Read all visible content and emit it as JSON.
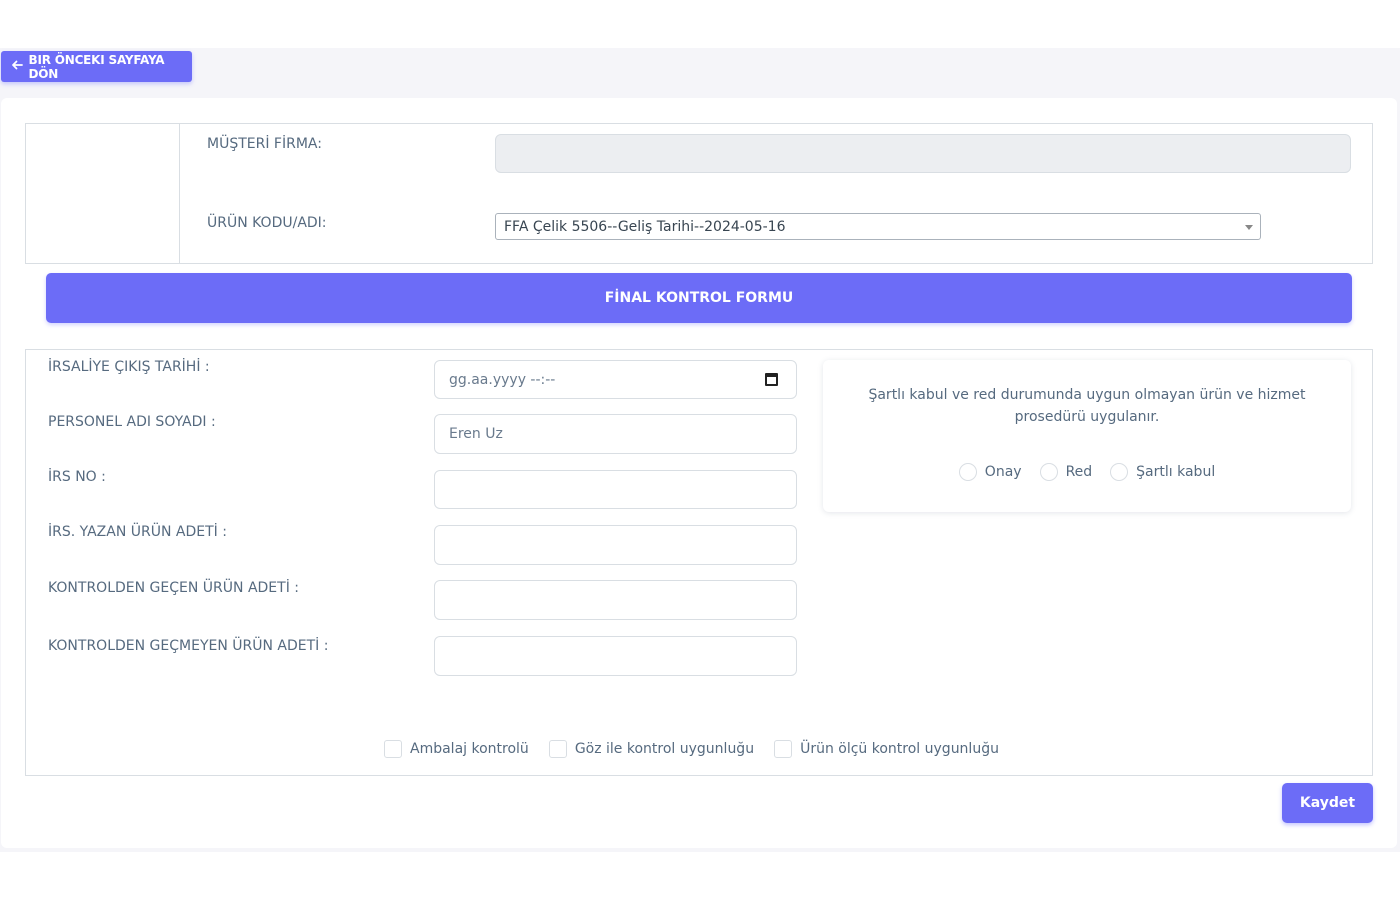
{
  "nav": {
    "back_label": "BIR ÖNCEKI SAYFAYA DÖN"
  },
  "header": {
    "customer_label": "MÜŞTERİ FİRMA:",
    "customer_value": "",
    "product_label": "ÜRÜN KODU/ADI:",
    "product_value": "FFA Çelik 5506--Geliş Tarihi--2024-05-16"
  },
  "form": {
    "title": "FİNAL KONTROL FORMU",
    "fields": [
      {
        "label": "İRSALİYE ÇIKIŞ TARİHİ :",
        "value": "gg.aa.yyyy --:--"
      },
      {
        "label": "PERSONEL ADI SOYADI :",
        "value": "Eren Uz"
      },
      {
        "label": "İRS NO :",
        "value": ""
      },
      {
        "label": "İRS. YAZAN ÜRÜN ADETİ :",
        "value": ""
      },
      {
        "label": "KONTROLDEN GEÇEN ÜRÜN ADETİ :",
        "value": ""
      },
      {
        "label": "KONTROLDEN GEÇMEYEN ÜRÜN ADETİ :",
        "value": ""
      }
    ],
    "note": "Şartlı kabul ve red durumunda uygun olmayan ürün ve hizmet prosedürü uygulanır.",
    "radio_options": [
      "Onay",
      "Red",
      "Şartlı kabul"
    ],
    "checkboxes": [
      "Ambalaj kontrolü",
      "Göz ile kontrol uygunluğu",
      "Ürün ölçü kontrol uygunluğu"
    ],
    "save_label": "Kaydet"
  },
  "colors": {
    "accent": "#6c6cf7",
    "border": "#d9dee3",
    "text": "#566a7f"
  },
  "icons": {
    "back": "arrow-left-icon",
    "date": "calendar-icon",
    "select": "caret-down-icon"
  }
}
